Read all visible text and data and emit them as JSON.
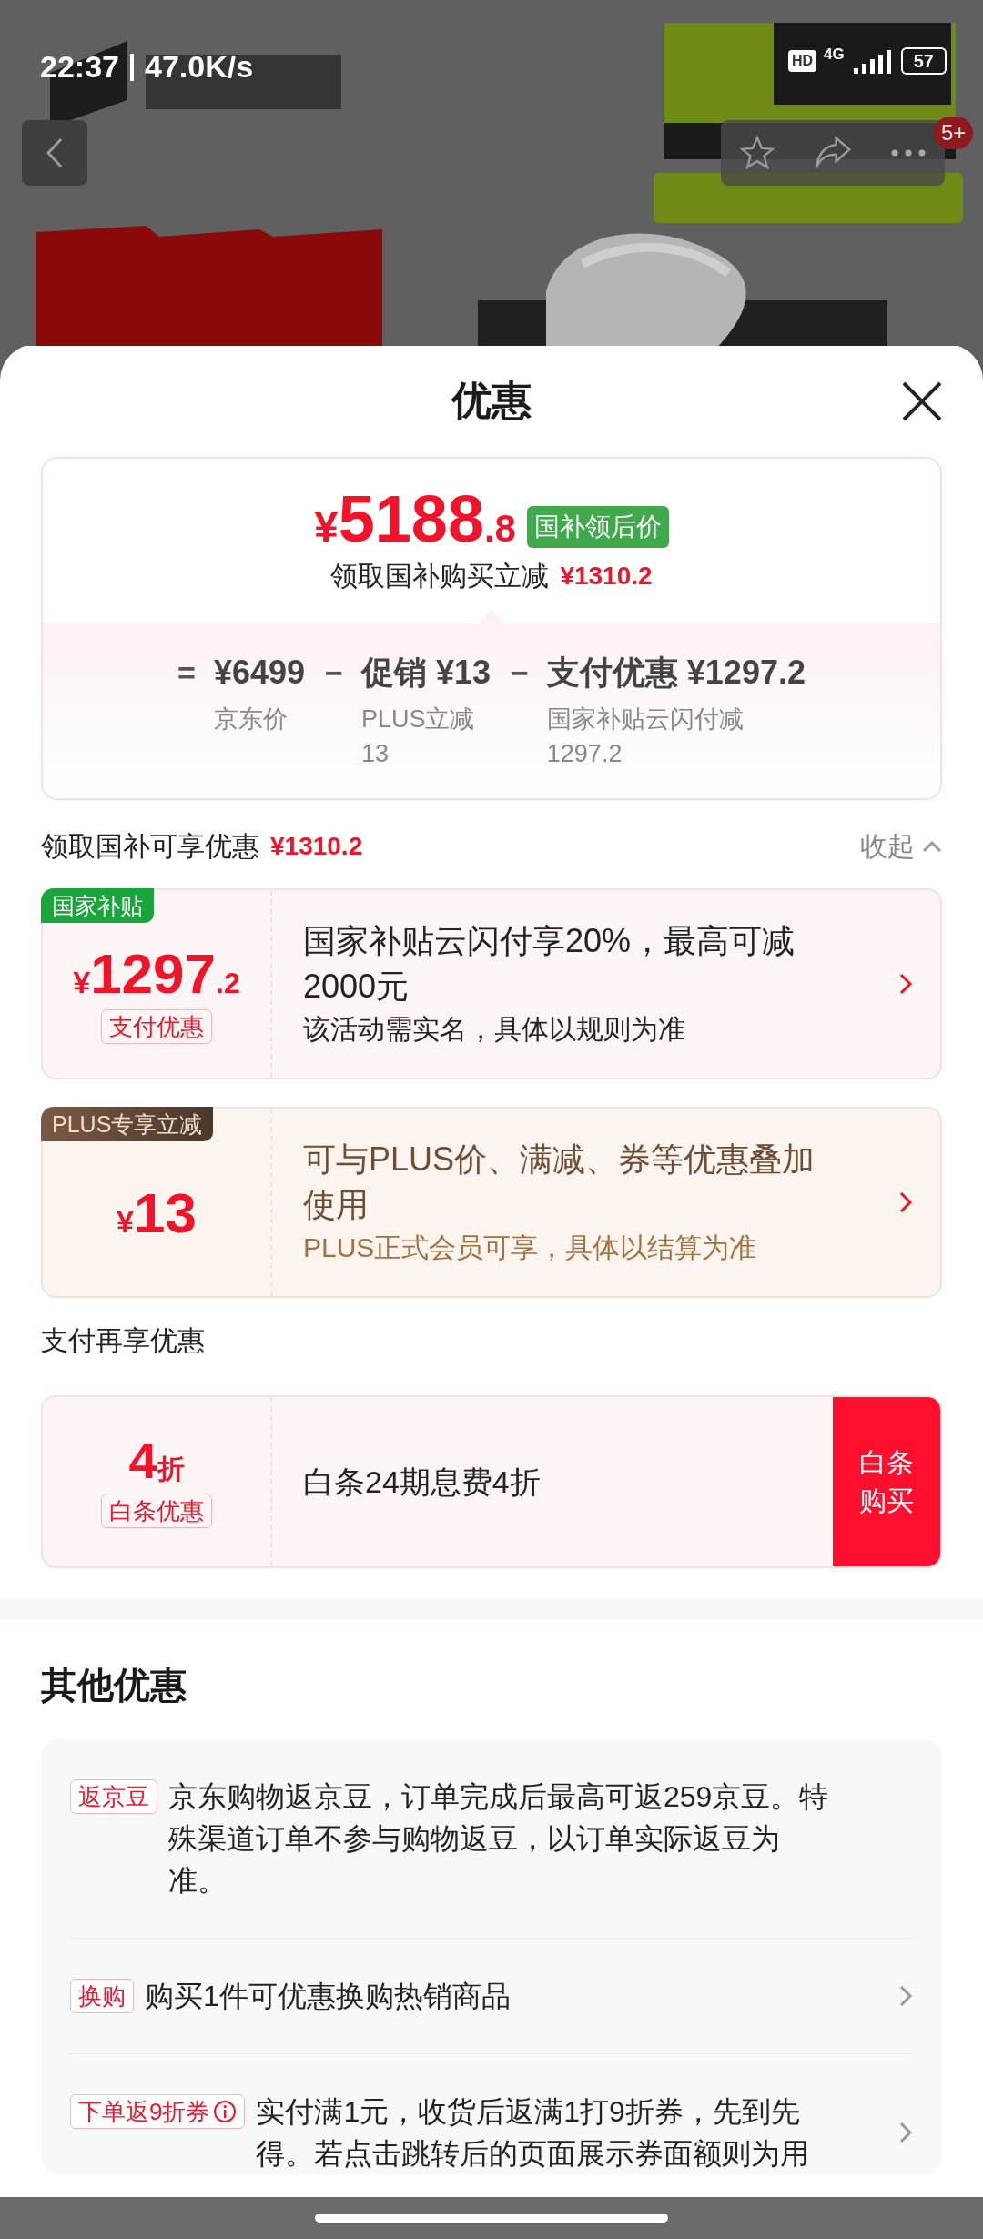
{
  "status_bar": {
    "time": "22:37",
    "speed": "47.0K/s",
    "hd": "HD",
    "network": "4G",
    "battery": "57"
  },
  "product_header": {
    "kind": "picture",
    "badge": "5+"
  },
  "sheet": {
    "title": "优惠"
  },
  "price_summary": {
    "currency": "¥",
    "integer": "5188",
    "decimal": ".8",
    "tag": "国补领后价",
    "saving_label": "领取国补购买立减",
    "saving_amount": "¥1310.2",
    "breakdown": [
      {
        "operator": "=",
        "amount": "¥6499",
        "note": [
          "京东价"
        ]
      },
      {
        "operator": "−",
        "amount": "促销 ¥13",
        "note": [
          "PLUS立减",
          "13"
        ]
      },
      {
        "operator": "−",
        "amount": "支付优惠 ¥1297.2",
        "note": [
          "国家补贴云闪付减",
          "1297.2"
        ]
      }
    ]
  },
  "subsidy_section": {
    "title": "领取国补可享优惠",
    "amount": "¥1310.2",
    "toggle": "收起",
    "expanded": true
  },
  "offers": [
    {
      "kind": "subsidy",
      "tag": "国家补贴",
      "currency": "¥",
      "integer": "1297",
      "decimal": ".2",
      "label": "支付优惠",
      "title": "国家补贴云闪付享20%，最高可减2000元",
      "desc": "该活动需实名，具体以规则为准"
    },
    {
      "kind": "plus",
      "tag": "PLUS专享立减",
      "currency": "¥",
      "integer": "13",
      "title": "可与PLUS价、满减、券等优惠叠加使用",
      "desc": "PLUS正式会员可享，具体以结算为准"
    }
  ],
  "payment_section": {
    "title": "支付再享优惠",
    "offer": {
      "value": "4",
      "unit": "折",
      "label": "白条优惠",
      "title": "白条24期息费4折",
      "button": "白条购买"
    }
  },
  "other_section": {
    "title": "其他优惠",
    "items": [
      {
        "tag": "返京豆",
        "info": false,
        "arrow": false,
        "text": "京东购物返京豆，订单完成后最高可返259京豆。特殊渠道订单不参与购物返豆，以订单实际返豆为准。"
      },
      {
        "tag": "换购",
        "info": false,
        "arrow": true,
        "text": "购买1件可优惠换购热销商品"
      },
      {
        "tag": "下单返9折券",
        "info": true,
        "arrow": true,
        "text": "实付满1元，收货后返满1打9折券，先到先得。若点击跳转后的页面展示券面额则为用"
      }
    ]
  }
}
